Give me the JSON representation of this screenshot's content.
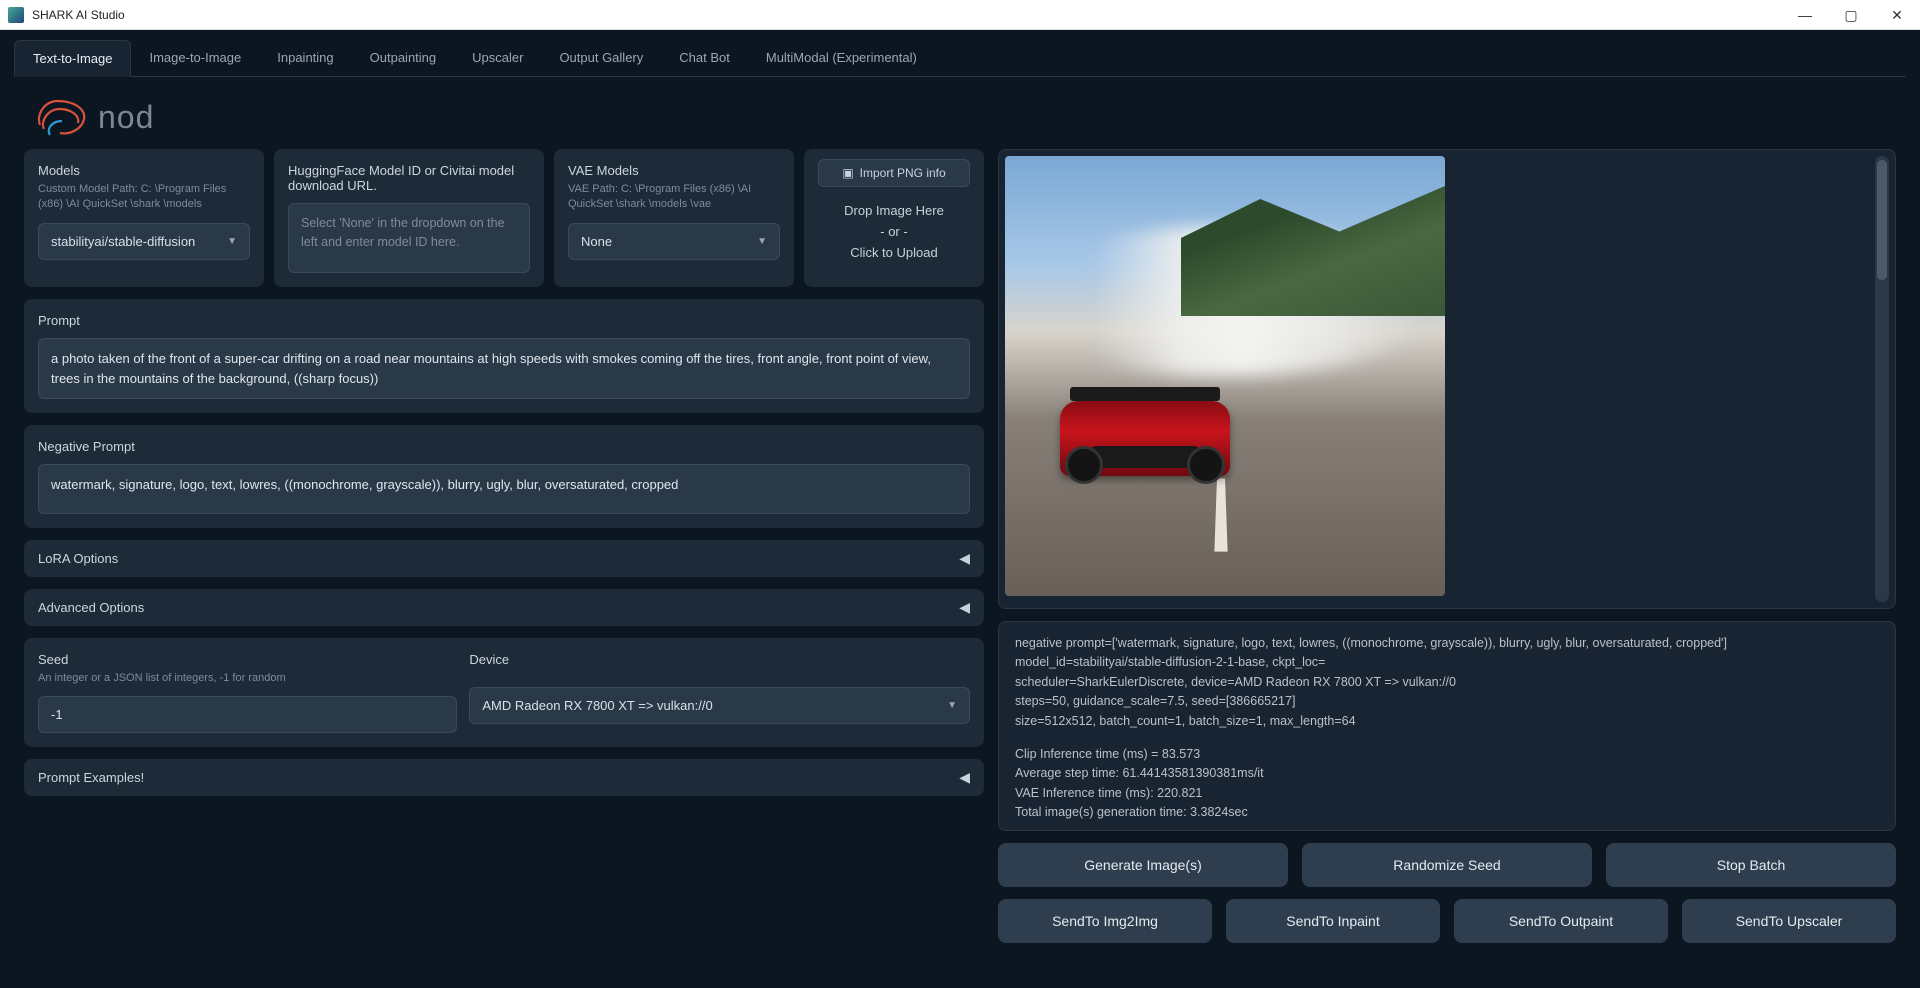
{
  "window": {
    "title": "SHARK AI Studio"
  },
  "tabs": [
    "Text-to-Image",
    "Image-to-Image",
    "Inpainting",
    "Outpainting",
    "Upscaler",
    "Output Gallery",
    "Chat Bot",
    "MultiModal (Experimental)"
  ],
  "logo_text": "nod",
  "models": {
    "label": "Models",
    "sub": "Custom Model Path: C: \\Program Files (x86) \\AI QuickSet \\shark \\models",
    "value": "stabilityai/stable-diffusion"
  },
  "hf": {
    "label": "HuggingFace Model ID or Civitai model download URL.",
    "placeholder": "Select 'None' in the dropdown on the left and enter model ID here."
  },
  "vae": {
    "label": "VAE Models",
    "sub": "VAE Path: C: \\Program Files (x86) \\AI QuickSet \\shark \\models \\vae",
    "value": "None"
  },
  "import": {
    "btn": "Import PNG info",
    "drop1": "Drop Image Here",
    "drop2": "- or -",
    "drop3": "Click to Upload"
  },
  "prompt": {
    "label": "Prompt",
    "value": "a photo taken of the front of a super-car drifting on a road near mountains at high speeds with smokes coming off the tires, front angle, front point of view, trees in the mountains of the background, ((sharp focus))"
  },
  "neg": {
    "label": "Negative Prompt",
    "value": "watermark, signature, logo, text, lowres, ((monochrome, grayscale)), blurry, ugly, blur, oversaturated, cropped"
  },
  "lora_label": "LoRA Options",
  "adv_label": "Advanced Options",
  "seed": {
    "label": "Seed",
    "sub": "An integer or a JSON list of integers, -1 for random",
    "value": "-1"
  },
  "device": {
    "label": "Device",
    "value": "AMD Radeon RX 7800 XT => vulkan://0"
  },
  "examples_label": "Prompt Examples!",
  "log": {
    "l1": "negative prompt=['watermark, signature, logo, text, lowres, ((monochrome, grayscale)), blurry, ugly, blur, oversaturated, cropped']",
    "l2": "model_id=stabilityai/stable-diffusion-2-1-base, ckpt_loc=",
    "l3": "scheduler=SharkEulerDiscrete, device=AMD Radeon RX 7800 XT => vulkan://0",
    "l4": "steps=50, guidance_scale=7.5, seed=[386665217]",
    "l5": "size=512x512, batch_count=1, batch_size=1, max_length=64",
    "l6": "Clip Inference time (ms) = 83.573",
    "l7": "Average step time: 61.44143581390381ms/it",
    "l8": "VAE Inference time (ms): 220.821",
    "l9": "Total image(s) generation time: 3.3824sec"
  },
  "buttons": {
    "generate": "Generate Image(s)",
    "rseed": "Randomize Seed",
    "stop": "Stop Batch",
    "img2img": "SendTo Img2Img",
    "inpaint": "SendTo Inpaint",
    "outpaint": "SendTo Outpaint",
    "upscaler": "SendTo Upscaler"
  }
}
